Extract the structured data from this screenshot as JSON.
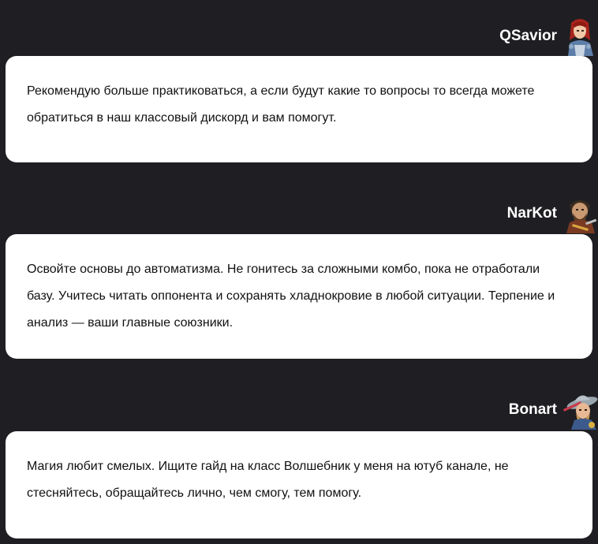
{
  "comments": [
    {
      "author": "QSavior",
      "avatar_icon": "warrior-woman-red-hair-avatar",
      "text": "Рекомендую больше практиковаться, а если будут какие то вопросы то всегда можете обратиться в наш классовый дискорд и вам помогут."
    },
    {
      "author": "NarKot",
      "avatar_icon": "bearded-warrior-avatar",
      "text": "Освойте основы до автоматизма. Не гонитесь за сложными комбо, пока не отработали базу. Учитесь читать оппонента и сохранять хладнокровие в любой ситуации. Терпение и анализ — ваши главные союзники."
    },
    {
      "author": "Bonart",
      "avatar_icon": "wizard-hat-avatar",
      "text": "Магия любит смелых. Ищите гайд на класс Волшебник у меня на ютуб канале, не стесняйтесь, обращайтесь лично, чем смогу, тем помогу."
    }
  ]
}
